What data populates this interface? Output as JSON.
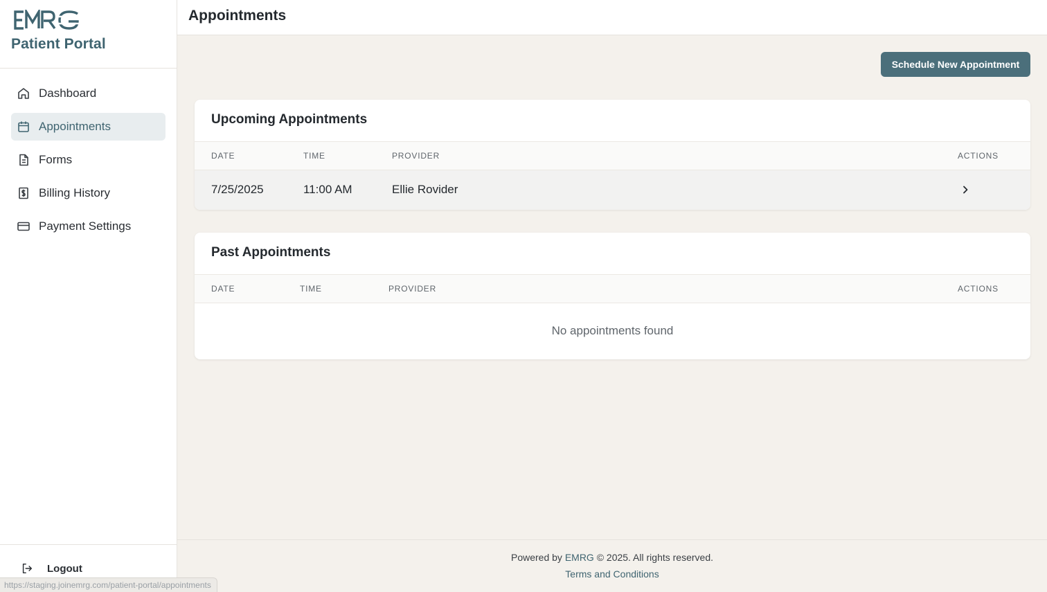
{
  "brand": {
    "logo_text": "EMRG",
    "portal_title": "Patient Portal",
    "accent_color": "#3f6470"
  },
  "sidebar": {
    "items": [
      {
        "label": "Dashboard",
        "icon": "home-icon",
        "active": false
      },
      {
        "label": "Appointments",
        "icon": "calendar-icon",
        "active": true
      },
      {
        "label": "Forms",
        "icon": "document-icon",
        "active": false
      },
      {
        "label": "Billing History",
        "icon": "dollar-receipt-icon",
        "active": false
      },
      {
        "label": "Payment Settings",
        "icon": "credit-card-icon",
        "active": false
      }
    ],
    "logout_label": "Logout"
  },
  "status_bar": {
    "url": "https://staging.joinemrg.com/patient-portal/appointments"
  },
  "header": {
    "title": "Appointments"
  },
  "actions": {
    "schedule_label": "Schedule New Appointment"
  },
  "upcoming": {
    "title": "Upcoming Appointments",
    "columns": [
      "DATE",
      "TIME",
      "PROVIDER",
      "ACTIONS"
    ],
    "rows": [
      {
        "date": "7/25/2025",
        "time": "11:00 AM",
        "provider": "Ellie Rovider",
        "action_icon": "chevron-right-icon"
      }
    ]
  },
  "past": {
    "title": "Past Appointments",
    "columns": [
      "DATE",
      "TIME",
      "PROVIDER",
      "ACTIONS"
    ],
    "empty_text": "No appointments found"
  },
  "footer": {
    "powered_prefix": "Powered by",
    "brand_link": "EMRG",
    "copyright": "© 2025. All rights reserved.",
    "terms_label": "Terms and Conditions"
  }
}
